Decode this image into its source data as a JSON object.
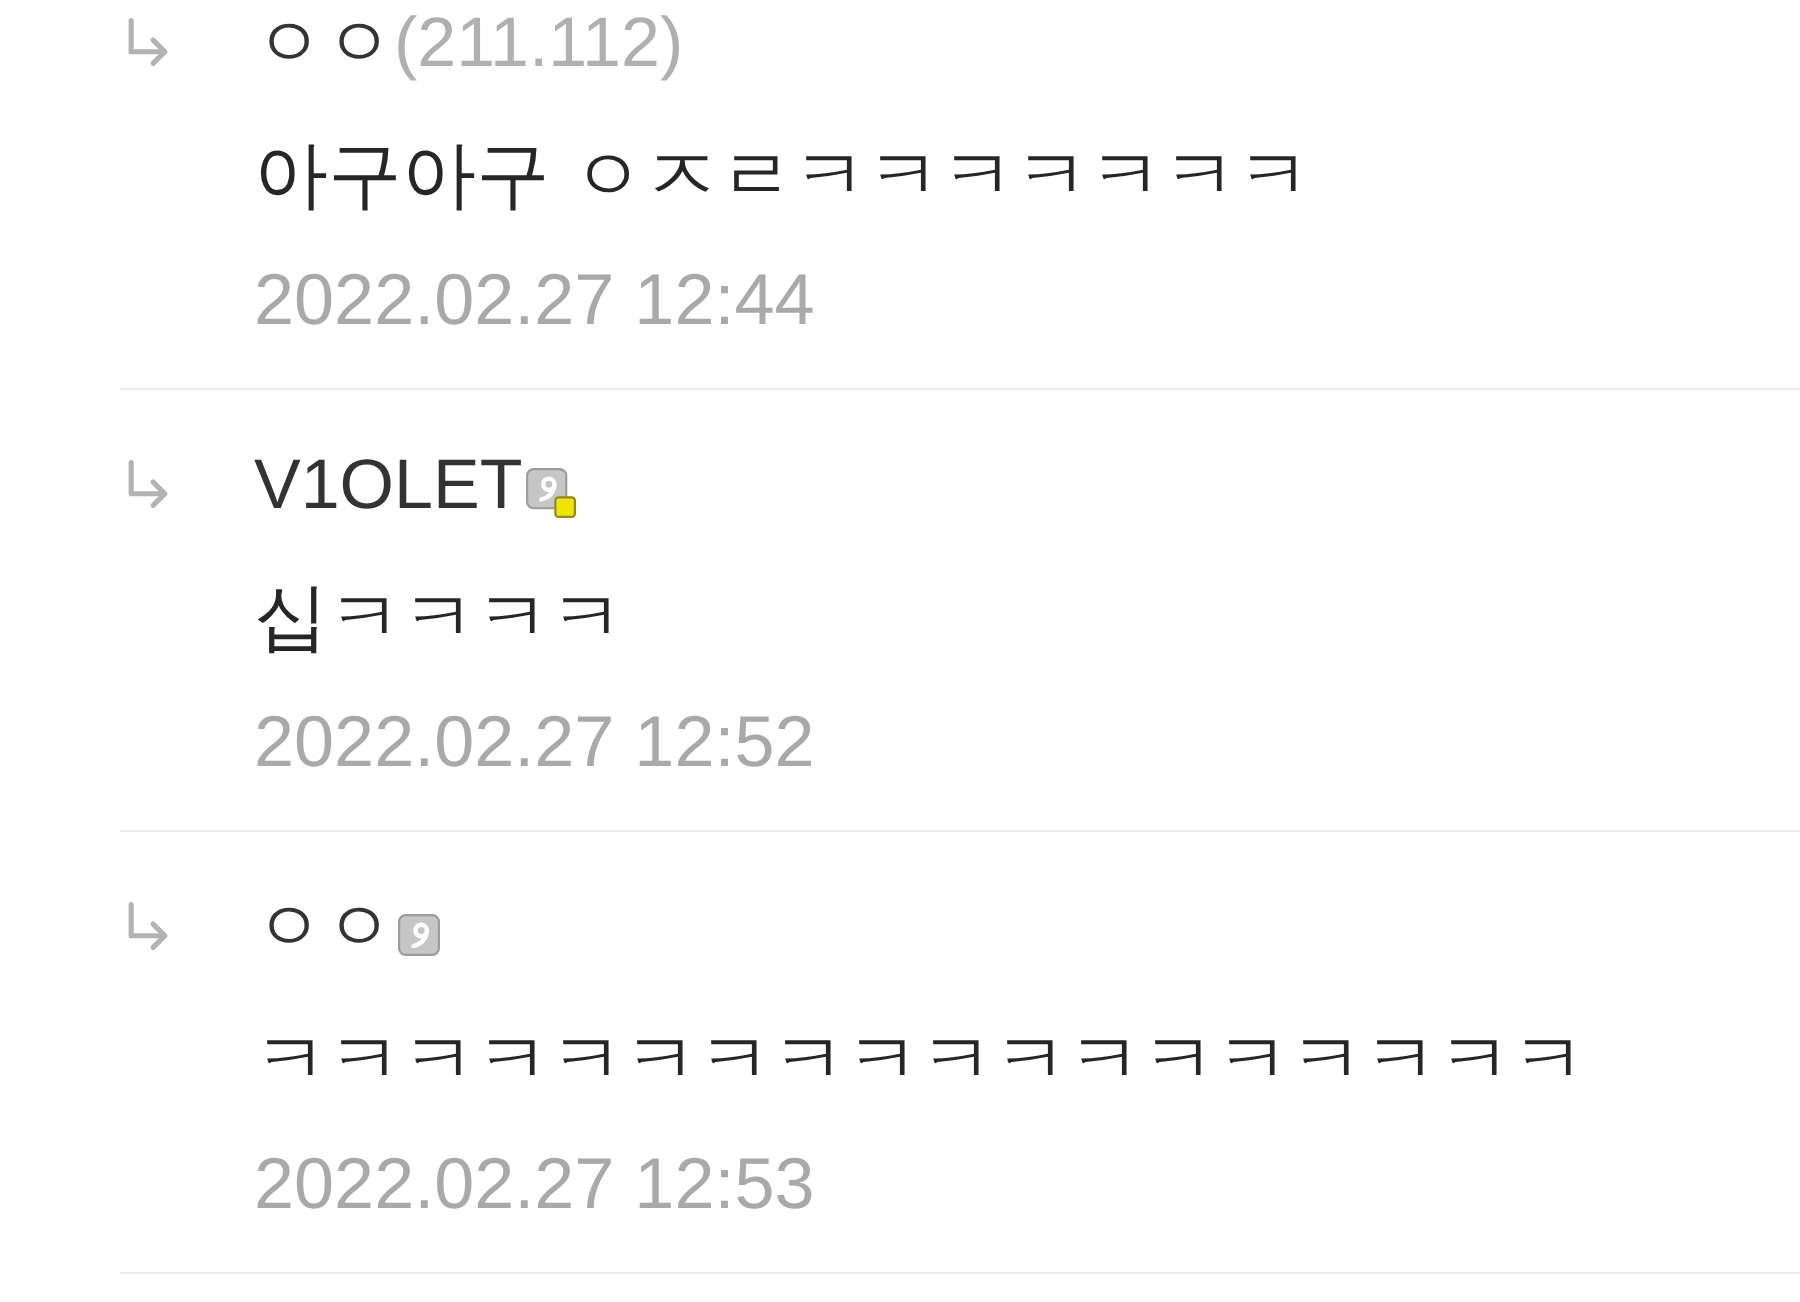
{
  "comments": [
    {
      "kind": "guest",
      "author": "ㅇㅇ",
      "ip": "(211.112)",
      "text": "아구아구 ㅇㅈㄹㅋㅋㅋㅋㅋㅋㅋ",
      "time": "2022.02.27 12:44"
    },
    {
      "kind": "flagged",
      "author": "V1OLET",
      "text": "십ㅋㅋㅋㅋ",
      "time": "2022.02.27 12:52"
    },
    {
      "kind": "plain",
      "author": "ㅇㅇ",
      "text": "ㅋㅋㅋㅋㅋㅋㅋㅋㅋㅋㅋㅋㅋㅋㅋㅋㅋㅋ",
      "time": "2022.02.27 12:53"
    }
  ]
}
